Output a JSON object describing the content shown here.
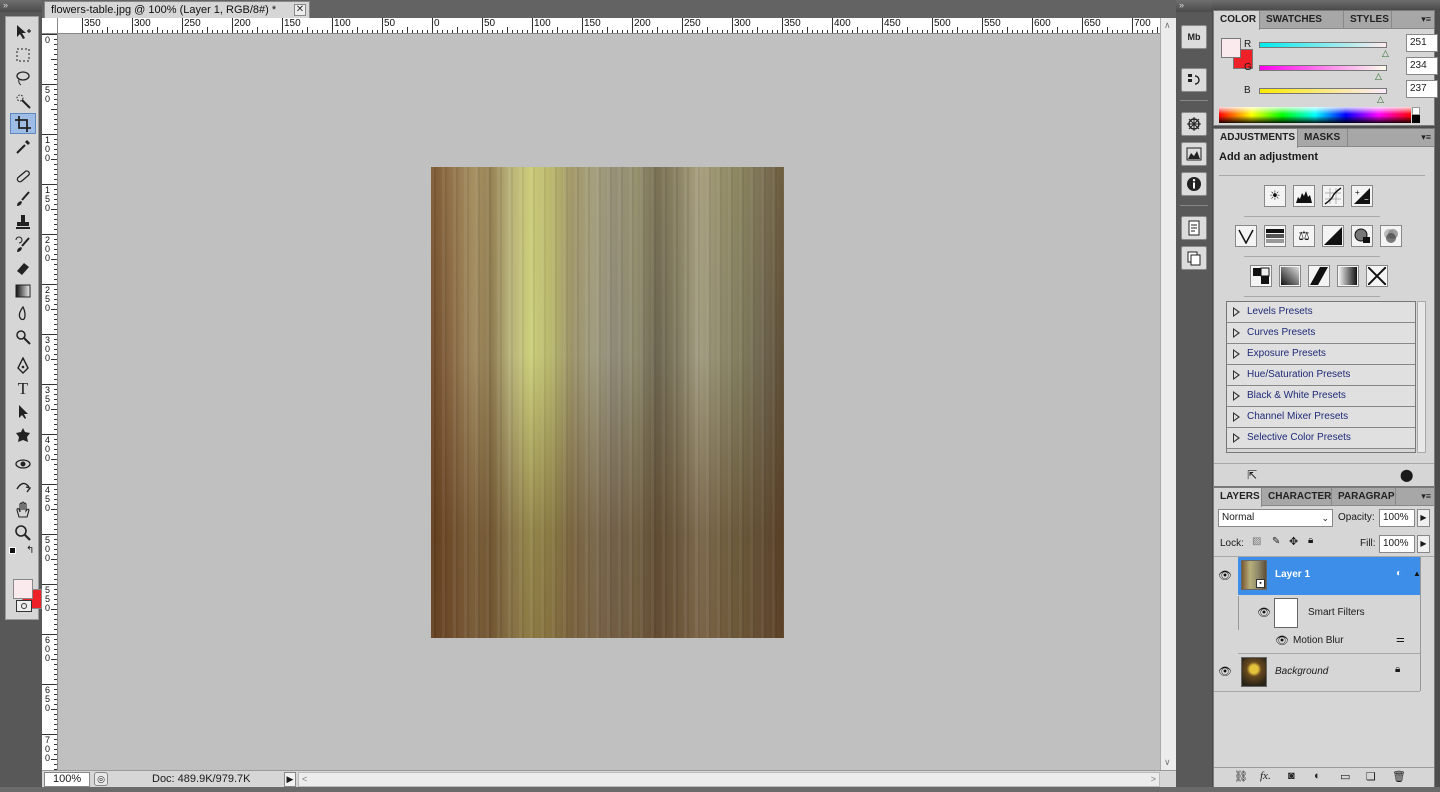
{
  "document": {
    "tab_title": "flowers-table.jpg @ 100% (Layer 1, RGB/8#) *",
    "close_glyph": "✕",
    "ruler_h_labels": [
      "350",
      "300",
      "250",
      "200",
      "150",
      "100",
      "50",
      "0",
      "50",
      "100",
      "150",
      "200",
      "250",
      "300",
      "350",
      "400",
      "450",
      "500",
      "550",
      "600",
      "650",
      "700"
    ],
    "ruler_v_labels": [
      "0",
      "50",
      "100",
      "150",
      "200",
      "250",
      "300",
      "350",
      "400",
      "450",
      "500",
      "550",
      "600",
      "650",
      "700"
    ],
    "zoom": "100%",
    "doc_info": "Doc: 489.9K/979.7K"
  },
  "toolbox": {
    "tools": [
      "move-tool",
      "marquee-tool",
      "lasso-tool",
      "quick-selection-tool",
      "crop-tool",
      "eyedropper-tool",
      "healing-brush-tool",
      "brush-tool",
      "clone-stamp-tool",
      "history-brush-tool",
      "eraser-tool",
      "gradient-tool",
      "blur-tool",
      "dodge-tool",
      "pen-tool",
      "type-tool",
      "path-selection-tool",
      "shape-tool",
      "3d-rotate-tool",
      "3d-orbit-tool",
      "hand-tool",
      "zoom-tool"
    ],
    "active_tool": "crop-tool",
    "foreground_color": "#fbeaed",
    "background_color": "#ee2028"
  },
  "color_panel": {
    "tabs": [
      "COLOR",
      "SWATCHES",
      "STYLES"
    ],
    "r_label": "R",
    "r_value": "251",
    "g_label": "G",
    "g_value": "234",
    "b_label": "B",
    "b_value": "237",
    "foreground": "#fbeaed",
    "background": "#ee2028"
  },
  "adjustments_panel": {
    "tabs": [
      "ADJUSTMENTS",
      "MASKS"
    ],
    "title": "Add an adjustment",
    "presets": [
      "Levels Presets",
      "Curves Presets",
      "Exposure Presets",
      "Hue/Saturation Presets",
      "Black & White Presets",
      "Channel Mixer Presets",
      "Selective Color Presets"
    ]
  },
  "layers_panel": {
    "tabs": [
      "LAYERS",
      "CHARACTER",
      "PARAGRAPH"
    ],
    "blend_mode": "Normal",
    "opacity_label": "Opacity:",
    "opacity_value": "100%",
    "lock_label": "Lock:",
    "fill_label": "Fill:",
    "fill_value": "100%",
    "layers": {
      "layer1": "Layer 1",
      "smart_filters": "Smart Filters",
      "motion_blur": "Motion Blur",
      "background": "Background"
    },
    "selected_color": "#3d8ee8"
  },
  "dock_icons": [
    "mini-bridge-icon",
    "history-icon",
    "navigator-icon",
    "histogram-icon",
    "info-icon",
    "notes-icon",
    "clone-source-icon"
  ]
}
